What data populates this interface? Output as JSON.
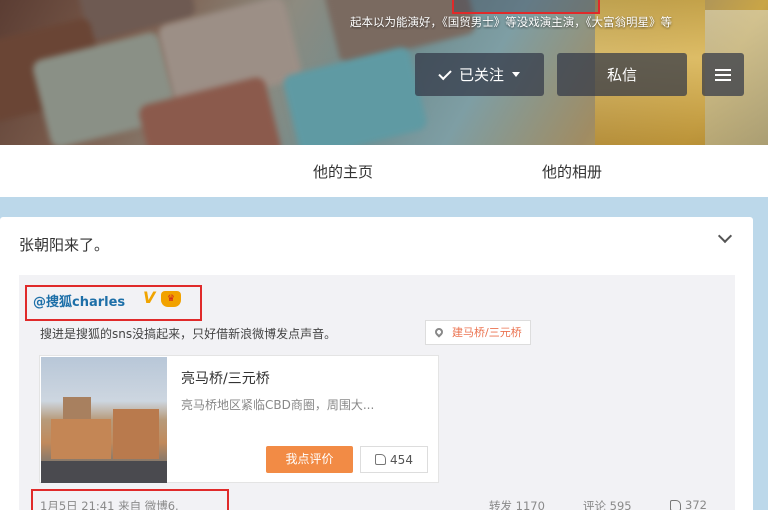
{
  "cover": {
    "intro": "起本以为能演好，《国贸男士》等没戏演主演，《大富翁明星》等",
    "follow_label": "已关注",
    "message_label": "私信"
  },
  "tabs": [
    {
      "label": "他的主页"
    },
    {
      "label": "他的相册"
    }
  ],
  "post": {
    "text": "张朝阳来了。",
    "repost": {
      "author": "@搜狐charles",
      "text": "搜进是搜狐的sns没搞起来，只好借新浪微博发点声音。",
      "location_tag": "建马桥/三元桥",
      "place": {
        "title": "亮马桥/三元桥",
        "description": "亮马桥地区紧临CBD商圈，周围大...",
        "comment_button": "我点评价",
        "likes": "454"
      },
      "time": "1月5日 21:41 来自 微博6.",
      "share": "转发 1170",
      "comments": "评论 595",
      "likes": "372"
    }
  },
  "colors": {
    "highlight_red": "#e02a2a",
    "link_blue": "#1d6fa8",
    "accent_orange": "#f28b45",
    "page_bg": "#bcd8ea"
  }
}
